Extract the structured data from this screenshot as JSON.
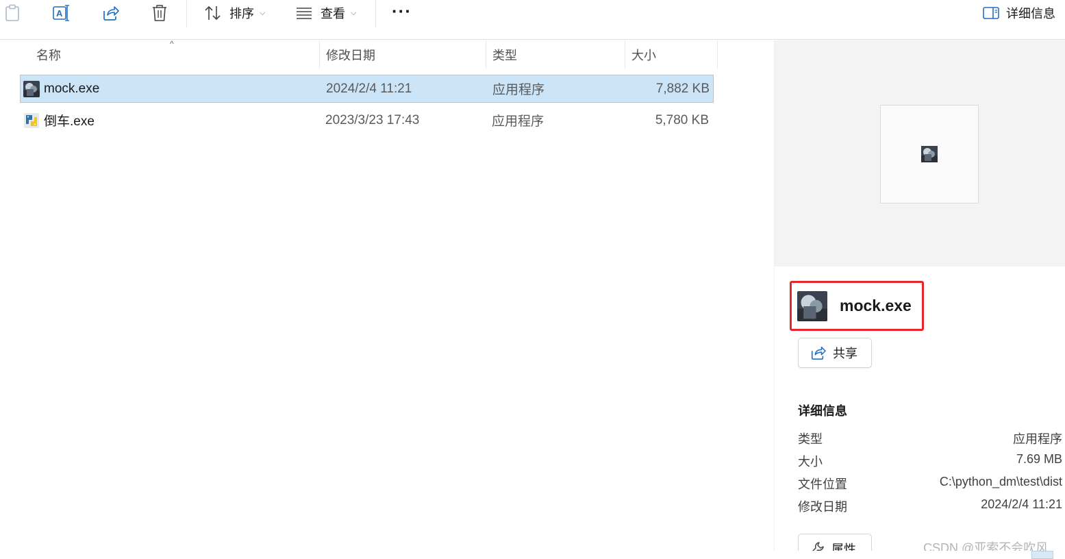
{
  "toolbar": {
    "sort_label": "排序",
    "view_label": "查看",
    "details_label": "详细信息"
  },
  "columns": {
    "name": "名称",
    "date": "修改日期",
    "type": "类型",
    "size": "大小"
  },
  "files": [
    {
      "name": "mock.exe",
      "date": "2024/2/4 11:21",
      "type": "应用程序",
      "size": "7,882 KB",
      "selected": true
    },
    {
      "name": "倒车.exe",
      "date": "2023/3/23 17:43",
      "type": "应用程序",
      "size": "5,780 KB",
      "selected": false
    }
  ],
  "details_pane": {
    "file_name": "mock.exe",
    "share_label": "共享",
    "section_title": "详细信息",
    "props": [
      {
        "key": "类型",
        "value": "应用程序"
      },
      {
        "key": "大小",
        "value": "7.69 MB"
      },
      {
        "key": "文件位置",
        "value": "C:\\python_dm\\test\\dist"
      },
      {
        "key": "修改日期",
        "value": "2024/2/4 11:21"
      }
    ],
    "properties_label": "属性"
  },
  "watermark": "CSDN @亚索不会吹风",
  "colors": {
    "selection_bg": "#cce4f7",
    "selection_border": "#99c9ef",
    "highlight_box": "#e8262a",
    "icon_blue": "#1f6fc4"
  }
}
